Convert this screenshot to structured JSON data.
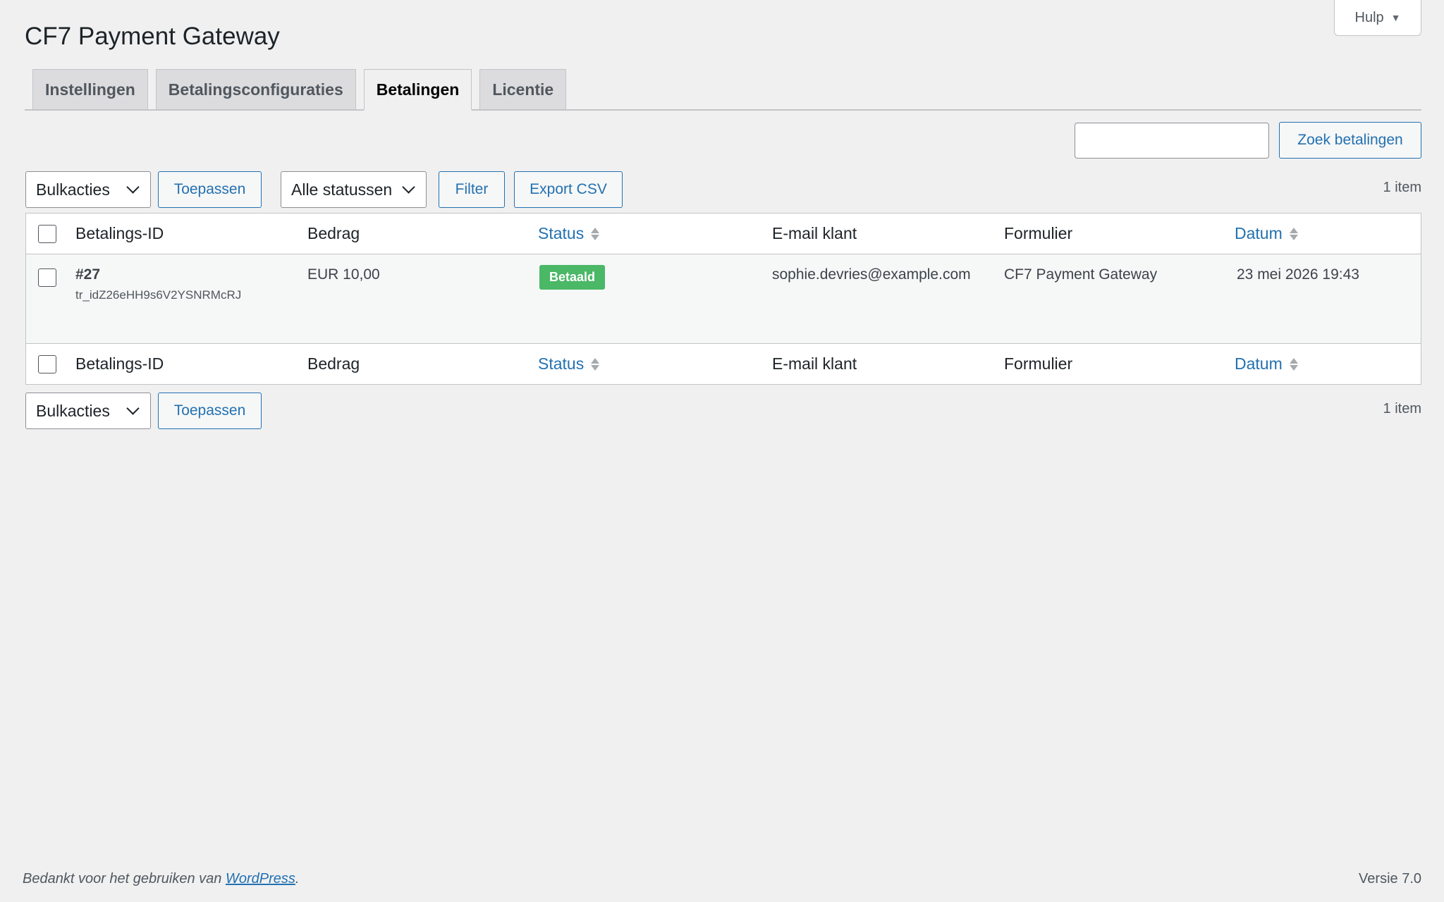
{
  "help": {
    "label": "Hulp",
    "caret": "▼"
  },
  "page_title": "CF7 Payment Gateway",
  "tabs": [
    {
      "label": "Instellingen"
    },
    {
      "label": "Betalingsconfiguraties"
    },
    {
      "label": "Betalingen",
      "active": true
    },
    {
      "label": "Licentie"
    }
  ],
  "search": {
    "placeholder": "",
    "button_label": "Zoek betalingen"
  },
  "top_actions": {
    "bulk_select": "Bulkacties",
    "apply_label": "Toepassen",
    "status_select": "Alle statussen",
    "filter_label": "Filter",
    "export_label": "Export CSV",
    "count": "1 item"
  },
  "table": {
    "columns": {
      "id": "Betalings-ID",
      "amount": "Bedrag",
      "status": "Status",
      "email": "E-mail klant",
      "form": "Formulier",
      "date": "Datum"
    },
    "rows": [
      {
        "id": "#27",
        "transaction": "tr_idZ26eHH9s6V2YSNRMcRJ",
        "amount": "EUR 10,00",
        "status": "Betaald",
        "email": "sophie.devries@example.com",
        "form": "CF7 Payment Gateway",
        "date": "23 mei 2026 19:43"
      }
    ]
  },
  "bottom_actions": {
    "bulk_select": "Bulkacties",
    "apply_label": "Toepassen",
    "count": "1 item"
  },
  "footer": {
    "thanks_prefix": "Bedankt voor het gebruiken van ",
    "link": "WordPress",
    "suffix": ".",
    "version": "Versie 7.0"
  },
  "colors": {
    "accent": "#2271b1",
    "badge_paid": "#4ab866",
    "background": "#f0f0f1"
  }
}
